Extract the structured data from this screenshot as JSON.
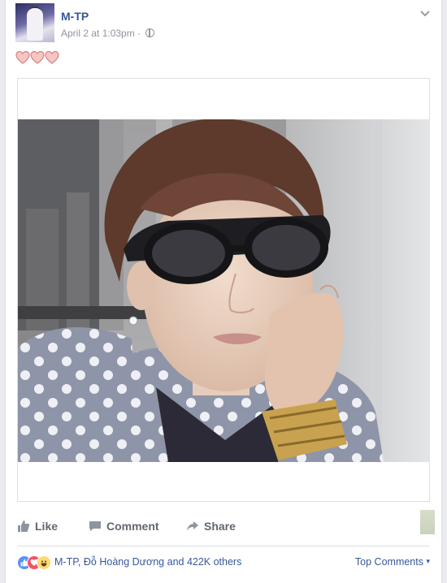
{
  "post": {
    "author": "M-TP",
    "timestamp": "April 2 at 1:03pm",
    "separator": "·",
    "privacy_icon": "globe-icon",
    "menu_icon": "chevron-down-icon",
    "caption_icon": "three-hearts"
  },
  "actions": {
    "like": "Like",
    "comment": "Comment",
    "share": "Share"
  },
  "reactions": {
    "icons": [
      "like-reaction-icon",
      "love-reaction-icon",
      "haha-reaction-icon"
    ],
    "summary": "M-TP, Đỗ Hoàng Dương and 422K others",
    "top_comments": "Top Comments"
  },
  "colors": {
    "link": "#365899",
    "muted": "#90949c",
    "action": "#616770",
    "like": "#5890ff",
    "love": "#f25268",
    "haha": "#ffd972"
  }
}
